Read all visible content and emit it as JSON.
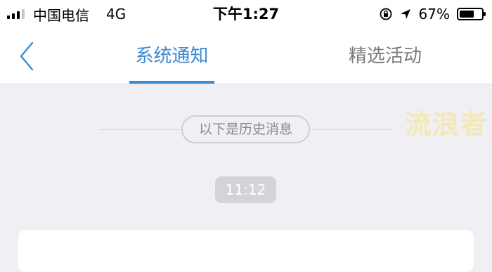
{
  "status_bar": {
    "carrier": "中国电信",
    "network": "4G",
    "time": "下午1:27",
    "battery_percent": "67%",
    "battery_level": 0.67,
    "icons": [
      "signal-bars-icon",
      "rotation-lock-icon",
      "location-arrow-icon",
      "battery-icon"
    ]
  },
  "nav": {
    "back_icon": "chevron-left-icon",
    "tabs": [
      {
        "label": "系统通知",
        "active": true
      },
      {
        "label": "精选活动",
        "active": false
      }
    ],
    "accent_color": "#3a8ad2"
  },
  "content": {
    "history_label": "以下是历史消息",
    "watermark": "流浪者",
    "time_badge": "11:12"
  }
}
